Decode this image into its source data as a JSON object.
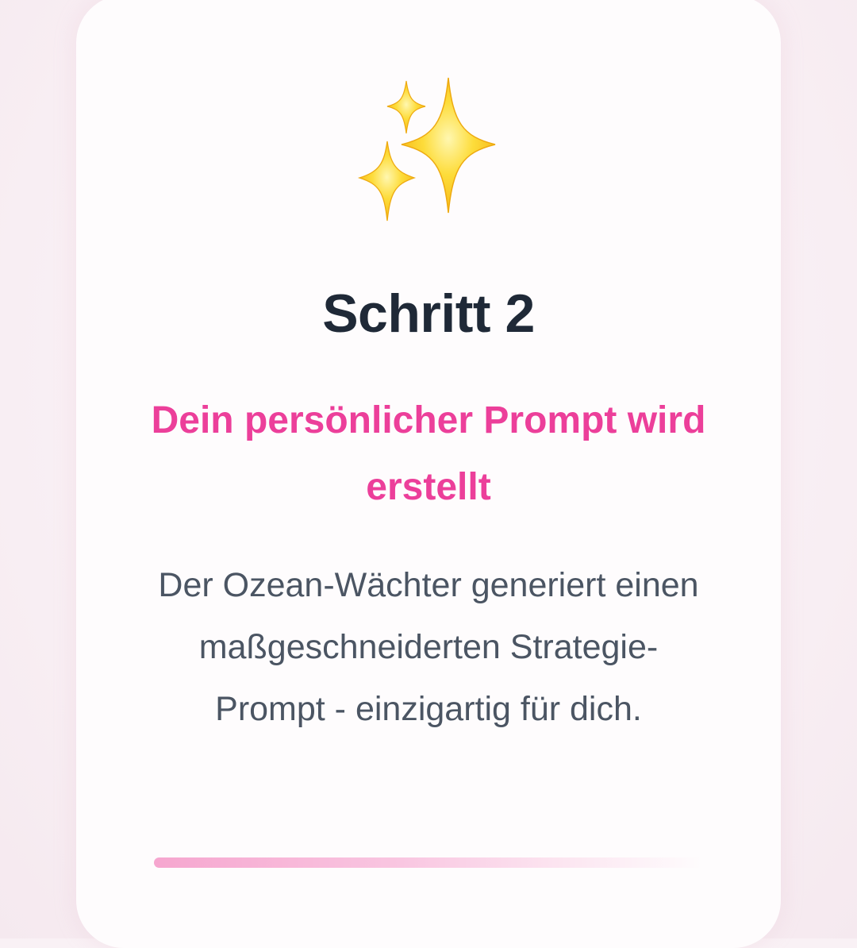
{
  "card": {
    "icon": "sparkles-icon",
    "step_title": "Schritt 2",
    "subtitle": "Dein persönlicher Prompt wird erstellt",
    "description": "Der Ozean-Wächter generiert einen maßgeschneiderten Strategie-Prompt - einzigartig für dich.",
    "progress": 1.0
  },
  "colors": {
    "title": "#1f2937",
    "accent": "#ec3f9a",
    "body_text": "#4b5563",
    "sparkle": "#fcd535",
    "progress_start": "#f6a6cf"
  }
}
